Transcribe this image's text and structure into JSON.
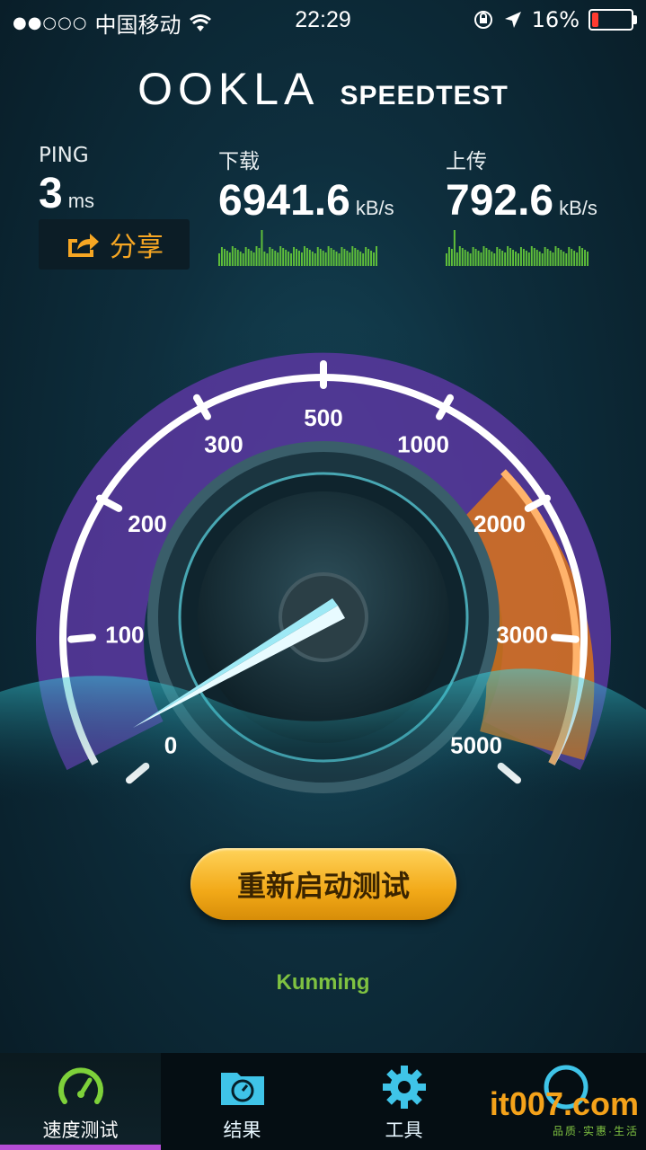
{
  "status_bar": {
    "signal_dots": "●●○○○",
    "carrier": "中国移动",
    "time": "22:29",
    "battery_percent": "16%",
    "battery_level": 0.16
  },
  "header": {
    "logo": "OOKLA",
    "product": "SPEEDTEST"
  },
  "stats": {
    "ping": {
      "label": "PING",
      "value": "3",
      "unit": "ms"
    },
    "download": {
      "label": "下载",
      "value": "6941.6",
      "unit": "kB/s"
    },
    "upload": {
      "label": "上传",
      "value": "792.6",
      "unit": "kB/s"
    }
  },
  "share_label": "分享",
  "gauge": {
    "ticks": [
      "0",
      "100",
      "200",
      "300",
      "500",
      "1000",
      "2000",
      "3000",
      "5000"
    ],
    "needle_value": "0"
  },
  "restart_label": "重新启动测试",
  "server": "Kunming",
  "tabs": [
    {
      "label": "速度测试",
      "icon": "speedometer-icon",
      "active": true
    },
    {
      "label": "结果",
      "icon": "folder-results-icon"
    },
    {
      "label": "工具",
      "icon": "gear-icon"
    },
    {
      "label": "",
      "icon": "info-icon"
    }
  ],
  "watermark": {
    "text": "it007.com",
    "sub": "品质·实惠·生活"
  },
  "colors": {
    "accent": "#f6a623",
    "server_green": "#7fc241",
    "gauge_purple": "#6a3fb0",
    "gauge_orange": "#e8801f"
  }
}
